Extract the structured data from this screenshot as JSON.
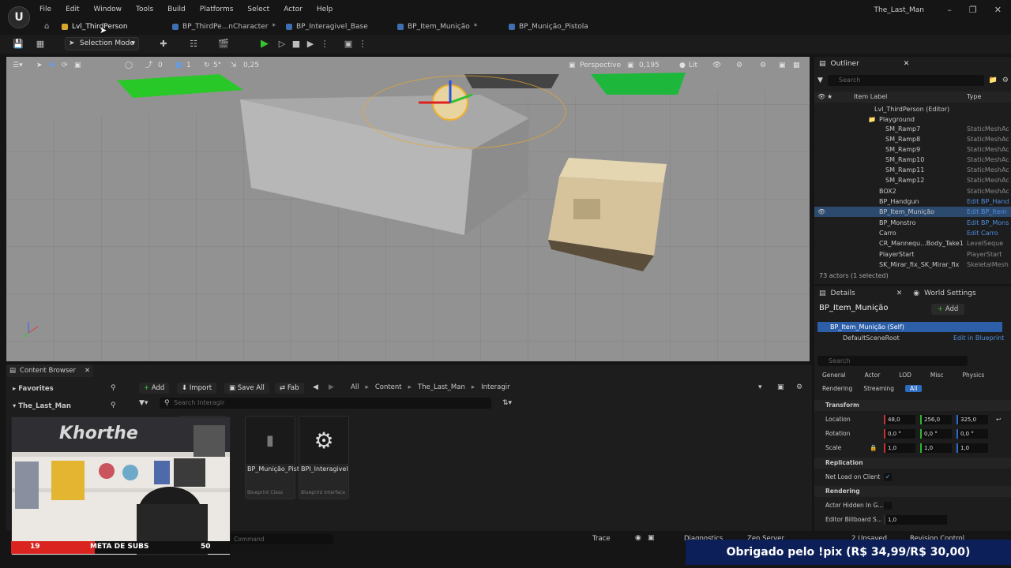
{
  "window": {
    "title": "The_Last_Man",
    "menu": [
      "File",
      "Edit",
      "Window",
      "Tools",
      "Build",
      "Platforms",
      "Select",
      "Actor",
      "Help"
    ],
    "tabs": [
      "Lvl_ThirdPerson",
      "BP_ThirdPe...nCharacter",
      "BP_Interagivel_Base",
      "BP_Item_Munição",
      "BP_Munição_Pistola"
    ],
    "tab_modified_marks": [
      "",
      "*",
      "",
      "*",
      ""
    ]
  },
  "toolbar": {
    "selection_mode": "Selection Mode"
  },
  "viewport": {
    "grid_angle": "0",
    "grid_move": "1",
    "grid_rotate": "5°",
    "grid_scale": "0,25",
    "perspective": "Perspective",
    "camera_speed": "0,195",
    "lit": "Lit"
  },
  "outliner": {
    "title": "Outliner",
    "search_placeholder": "Search",
    "col_label": "Item Label",
    "col_type": "Type",
    "rows": [
      {
        "label": "Lvl_ThirdPerson (Editor)",
        "type": ""
      },
      {
        "label": "Playground",
        "type": ""
      },
      {
        "label": "SM_Ramp7",
        "type": "StaticMeshAc"
      },
      {
        "label": "SM_Ramp8",
        "type": "StaticMeshAc"
      },
      {
        "label": "SM_Ramp9",
        "type": "StaticMeshAc"
      },
      {
        "label": "SM_Ramp10",
        "type": "StaticMeshAc"
      },
      {
        "label": "SM_Ramp11",
        "type": "StaticMeshAc"
      },
      {
        "label": "SM_Ramp12",
        "type": "StaticMeshAc"
      },
      {
        "label": "BOX2",
        "type": "StaticMeshAc"
      },
      {
        "label": "BP_Handgun",
        "type": "Edit BP_Hand"
      },
      {
        "label": "BP_Item_Munição",
        "type": "Edit BP_Item"
      },
      {
        "label": "BP_Monstro",
        "type": "Edit BP_Mons"
      },
      {
        "label": "Carro",
        "type": "Edit Carro"
      },
      {
        "label": "CR_Mannequ...Body_Take1",
        "type": "LevelSeque"
      },
      {
        "label": "PlayerStart",
        "type": "PlayerStart"
      },
      {
        "label": "SK_Mirar_fix_SK_Mirar_fix",
        "type": "SkeletalMesh"
      }
    ],
    "footer": "73 actors (1 selected)"
  },
  "details": {
    "tab_details": "Details",
    "tab_world": "World Settings",
    "actor_name": "BP_Item_Munição",
    "add_label": "Add",
    "self_label": "BP_Item_Munição (Self)",
    "root_label": "DefaultSceneRoot",
    "edit_bp": "Edit in Blueprint",
    "search_placeholder": "Search",
    "filters": [
      "General",
      "Actor",
      "LOD",
      "Misc",
      "Physics",
      "Rendering",
      "Streaming",
      "All"
    ],
    "transform_header": "Transform",
    "location_label": "Location",
    "location": [
      "48,0",
      "256,0",
      "325,0"
    ],
    "rotation_label": "Rotation",
    "rotation": [
      "0,0 °",
      "0,0 °",
      "0,0 °"
    ],
    "scale_label": "Scale",
    "scale": [
      "1,0",
      "1,0",
      "1,0"
    ],
    "replication_header": "Replication",
    "net_load_label": "Net Load on Client",
    "rendering_header": "Rendering",
    "actor_hidden_label": "Actor Hidden In G...",
    "billboard_label": "Editor Billboard S...",
    "billboard_value": "1,0"
  },
  "content_browser": {
    "title": "Content Browser",
    "add": "Add",
    "import": "Import",
    "save_all": "Save All",
    "fab": "Fab",
    "favorites": "Favorites",
    "project": "The_Last_Man",
    "breadcrumb": [
      "All",
      "Content",
      "The_Last_Man",
      "Interagir"
    ],
    "search_placeholder": "Search Interagir",
    "assets": [
      {
        "name": "BP_Munição_Pistola",
        "kind": "Blueprint Class"
      },
      {
        "name": "BPI_Interagivel",
        "kind": "Blueprint Interface"
      }
    ],
    "cmd_placeholder": "Command"
  },
  "statusbar": {
    "trace": "Trace",
    "diagnostics": "Diagnostics",
    "zen": "Zen Server",
    "unsaved": "2 Unsaved",
    "revision": "Revision Control"
  },
  "stream": {
    "subs_current": "19",
    "subs_label": "META DE SUBS",
    "subs_goal": "50",
    "pix_message": "Obrigado pelo !pix (R$ 34,99/R$ 30,00)",
    "webcam_logo_text": "Khorthe"
  },
  "colors": {
    "accent_blue": "#2d6cc0",
    "play_green": "#38c431",
    "pix_bar": "#0d1f58",
    "subs_red": "#d9241f"
  }
}
